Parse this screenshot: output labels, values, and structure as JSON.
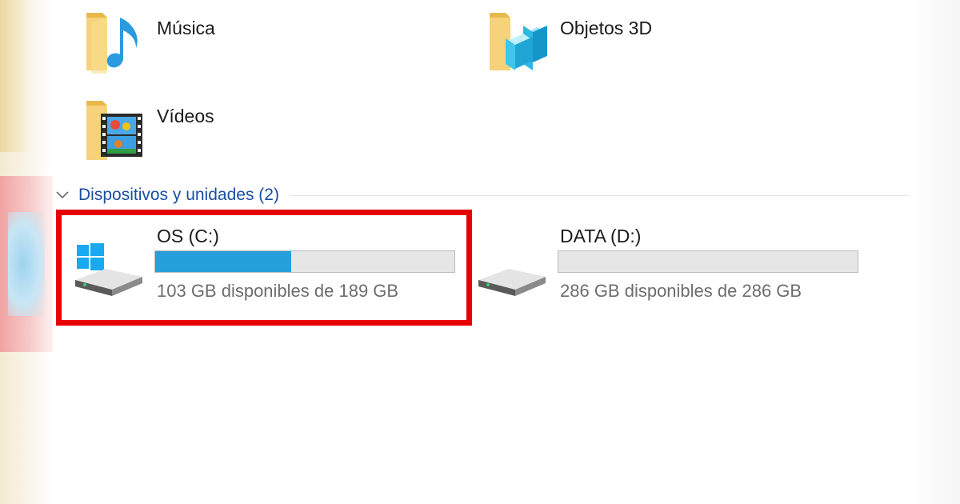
{
  "folders": [
    {
      "label": "Música",
      "icon": "music-folder-icon"
    },
    {
      "label": "Objetos 3D",
      "icon": "3d-objects-folder-icon"
    },
    {
      "label": "Vídeos",
      "icon": "videos-folder-icon"
    }
  ],
  "devices_group": {
    "title": "Dispositivos y unidades (2)",
    "icon": "chevron-down-icon"
  },
  "drives": [
    {
      "name": "OS (C:)",
      "free_text": "103 GB disponibles de 189 GB",
      "used_fraction": 0.455,
      "icon": "windows-drive-icon"
    },
    {
      "name": "DATA (D:)",
      "free_text": "286 GB disponibles de 286 GB",
      "used_fraction": 0.0,
      "icon": "hard-drive-icon"
    }
  ],
  "colors": {
    "accent_bar": "#26a0da",
    "group_title": "#1a4fa0",
    "highlight": "#e60000"
  }
}
